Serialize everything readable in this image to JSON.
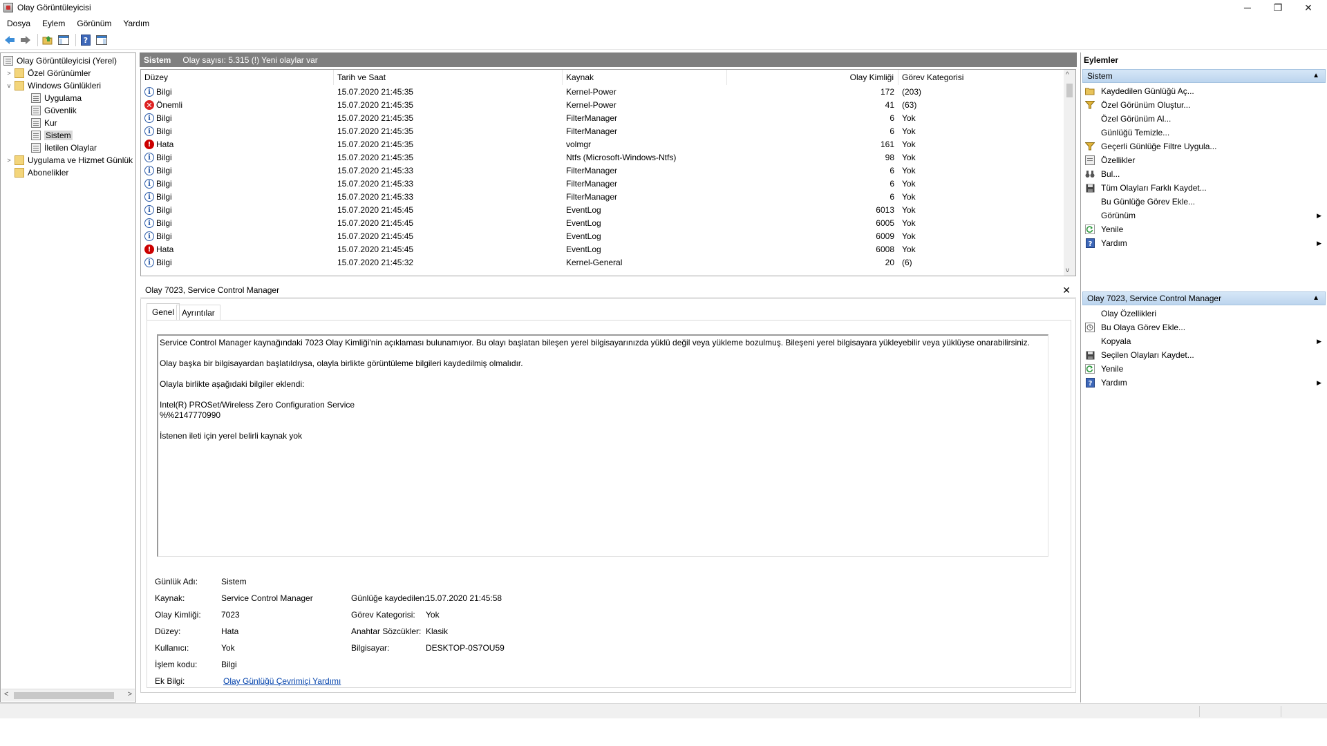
{
  "window": {
    "title": "Olay Görüntüleyicisi",
    "minimize_glyph": "─",
    "restore_glyph": "❐",
    "close_glyph": "✕"
  },
  "menu": [
    "Dosya",
    "Eylem",
    "Görünüm",
    "Yardım"
  ],
  "toolbar": {
    "icons": [
      "back-arrow-icon",
      "forward-arrow-icon",
      "open-folder-icon",
      "console-tree-icon",
      "help-icon",
      "action-pane-icon"
    ]
  },
  "tree": {
    "root": "Olay Görüntüleyicisi (Yerel)",
    "custom_views": "Özel Görünümler",
    "windows_logs": "Windows Günlükleri",
    "application": "Uygulama",
    "security": "Güvenlik",
    "setup": "Kur",
    "system": "Sistem",
    "forwarded": "İletilen Olaylar",
    "app_service_logs": "Uygulama ve Hizmet Günlük",
    "subscriptions": "Abonelikler"
  },
  "center": {
    "title": "Sistem",
    "info": "Olay sayısı: 5.315 (!) Yeni olaylar var"
  },
  "columns": {
    "level": "Düzey",
    "datetime": "Tarih ve Saat",
    "source": "Kaynak",
    "event_id": "Olay Kimliği",
    "category": "Görev Kategorisi"
  },
  "rows": [
    {
      "level": "Bilgi",
      "type": "info",
      "datetime": "15.07.2020 21:45:35",
      "source": "Kernel-Power",
      "event_id": "172",
      "category": "(203)"
    },
    {
      "level": "Önemli",
      "type": "critical",
      "datetime": "15.07.2020 21:45:35",
      "source": "Kernel-Power",
      "event_id": "41",
      "category": "(63)"
    },
    {
      "level": "Bilgi",
      "type": "info",
      "datetime": "15.07.2020 21:45:35",
      "source": "FilterManager",
      "event_id": "6",
      "category": "Yok"
    },
    {
      "level": "Bilgi",
      "type": "info",
      "datetime": "15.07.2020 21:45:35",
      "source": "FilterManager",
      "event_id": "6",
      "category": "Yok"
    },
    {
      "level": "Hata",
      "type": "error",
      "datetime": "15.07.2020 21:45:35",
      "source": "volmgr",
      "event_id": "161",
      "category": "Yok"
    },
    {
      "level": "Bilgi",
      "type": "info",
      "datetime": "15.07.2020 21:45:35",
      "source": "Ntfs (Microsoft-Windows-Ntfs)",
      "event_id": "98",
      "category": "Yok"
    },
    {
      "level": "Bilgi",
      "type": "info",
      "datetime": "15.07.2020 21:45:33",
      "source": "FilterManager",
      "event_id": "6",
      "category": "Yok"
    },
    {
      "level": "Bilgi",
      "type": "info",
      "datetime": "15.07.2020 21:45:33",
      "source": "FilterManager",
      "event_id": "6",
      "category": "Yok"
    },
    {
      "level": "Bilgi",
      "type": "info",
      "datetime": "15.07.2020 21:45:33",
      "source": "FilterManager",
      "event_id": "6",
      "category": "Yok"
    },
    {
      "level": "Bilgi",
      "type": "info",
      "datetime": "15.07.2020 21:45:45",
      "source": "EventLog",
      "event_id": "6013",
      "category": "Yok"
    },
    {
      "level": "Bilgi",
      "type": "info",
      "datetime": "15.07.2020 21:45:45",
      "source": "EventLog",
      "event_id": "6005",
      "category": "Yok"
    },
    {
      "level": "Bilgi",
      "type": "info",
      "datetime": "15.07.2020 21:45:45",
      "source": "EventLog",
      "event_id": "6009",
      "category": "Yok"
    },
    {
      "level": "Hata",
      "type": "error",
      "datetime": "15.07.2020 21:45:45",
      "source": "EventLog",
      "event_id": "6008",
      "category": "Yok"
    },
    {
      "level": "Bilgi",
      "type": "info",
      "datetime": "15.07.2020 21:45:32",
      "source": "Kernel-General",
      "event_id": "20",
      "category": "(6)"
    }
  ],
  "detail": {
    "title": "Olay 7023, Service Control Manager",
    "close_glyph": "✕",
    "tab_general": "Genel",
    "tab_details": "Ayrıntılar",
    "desc_line1": "Service Control Manager kaynağındaki 7023 Olay Kimliği'nin açıklaması bulunamıyor. Bu olayı başlatan bileşen yerel bilgisayarınızda yüklü değil veya yükleme bozulmuş. Bileşeni yerel bilgisayara yükleyebilir veya yüklüyse onarabilirsiniz.",
    "desc_line2": "Olay başka bir bilgisayardan başlatıldıysa, olayla birlikte görüntüleme bilgileri kaydedilmiş olmalıdır.",
    "desc_line3": "Olayla birlikte aşağıdaki bilgiler eklendi:",
    "desc_line4": "Intel(R) PROSet/Wireless Zero Configuration Service",
    "desc_line5": "%%2147770990",
    "desc_line6": "İstenen ileti için yerel belirli kaynak yok",
    "log_name_label": "Günlük Adı:",
    "log_name": "Sistem",
    "source_label": "Kaynak:",
    "source": "Service Control Manager",
    "logged_label": "Günlüğe kaydedilen:",
    "logged": "15.07.2020 21:45:58",
    "event_id_label": "Olay Kimliği:",
    "event_id": "7023",
    "task_label": "Görev Kategorisi:",
    "task": "Yok",
    "level_label": "Düzey:",
    "level": "Hata",
    "keywords_label": "Anahtar Sözcükler:",
    "keywords": "Klasik",
    "user_label": "Kullanıcı:",
    "user": "Yok",
    "computer_label": "Bilgisayar:",
    "computer": "DESKTOP-0S7OU59",
    "opcode_label": "İşlem kodu:",
    "opcode": "Bilgi",
    "more_info_label": "Ek Bilgi:",
    "more_info_link": "Olay Günlüğü Çevrimiçi Yardımı"
  },
  "actions": {
    "title": "Eylemler",
    "section1": "Sistem",
    "items1": [
      {
        "label": "Kaydedilen Günlüğü Aç...",
        "icon": "open-folder-icon",
        "sub": false
      },
      {
        "label": "Özel Görünüm Oluştur...",
        "icon": "filter-icon",
        "sub": false
      },
      {
        "label": "Özel Görünüm Al...",
        "icon": "",
        "sub": false
      },
      {
        "label": "Günlüğü Temizle...",
        "icon": "",
        "sub": false
      },
      {
        "label": "Geçerli Günlüğe Filtre Uygula...",
        "icon": "filter-icon",
        "sub": false
      },
      {
        "label": "Özellikler",
        "icon": "properties-icon",
        "sub": false
      },
      {
        "label": "Bul...",
        "icon": "binoculars-icon",
        "sub": false
      },
      {
        "label": "Tüm Olayları Farklı Kaydet...",
        "icon": "save-icon",
        "sub": false
      },
      {
        "label": "Bu Günlüğe Görev Ekle...",
        "icon": "",
        "sub": false
      },
      {
        "label": "Görünüm",
        "icon": "",
        "sub": true
      },
      {
        "label": "Yenile",
        "icon": "refresh-icon",
        "sub": false
      },
      {
        "label": "Yardım",
        "icon": "help-icon",
        "sub": true
      }
    ],
    "section2": "Olay 7023, Service Control Manager",
    "items2": [
      {
        "label": "Olay Özellikleri",
        "icon": "",
        "sub": false
      },
      {
        "label": "Bu Olaya Görev Ekle...",
        "icon": "task-icon",
        "sub": false
      },
      {
        "label": "Kopyala",
        "icon": "",
        "sub": true
      },
      {
        "label": "Seçilen Olayları Kaydet...",
        "icon": "save-icon",
        "sub": false
      },
      {
        "label": "Yenile",
        "icon": "refresh-icon",
        "sub": false
      },
      {
        "label": "Yardım",
        "icon": "help-icon",
        "sub": true
      }
    ]
  },
  "colors": {
    "header_gray": "#7f7f7f",
    "info_blue": "#2a5aa8",
    "error_red": "#c00000",
    "link_blue": "#0645ad"
  }
}
